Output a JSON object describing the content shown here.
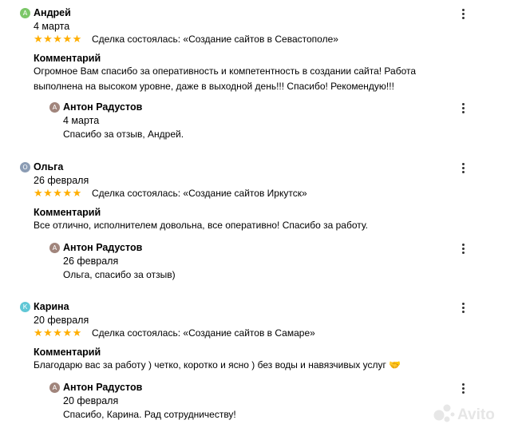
{
  "comment_label": "Комментарий",
  "stars_text": "★★★★★",
  "colors": {
    "avatar_green": "#7bc768",
    "avatar_gray_blue": "#8b9cb4",
    "avatar_teal": "#60c7d6",
    "avatar_brown": "#a1857c",
    "star": "#ffae00"
  },
  "reviews": [
    {
      "avatar_letter": "А",
      "author": "Андрей",
      "date": "4 марта",
      "deal": "Сделка состоялась: «Создание сайтов в Севастополе»",
      "comment": "Огромное Вам спасибо за оперативность и компетентность в создании сайта! Работа выполнена на высоком уровне, даже в выходной день!!! Спасибо! Рекомендую!!!",
      "reply": {
        "avatar_letter": "А",
        "author": "Антон Радустов",
        "date": "4 марта",
        "text": "Спасибо за отзыв, Андрей."
      }
    },
    {
      "avatar_letter": "О",
      "author": "Ольга",
      "date": "26 февраля",
      "deal": "Сделка состоялась: «Создание сайтов Иркутск»",
      "comment": "Все отлично, исполнителем довольна, все оперативно! Спасибо за работу.",
      "reply": {
        "avatar_letter": "А",
        "author": "Антон Радустов",
        "date": "26 февраля",
        "text": "Ольга, спасибо за отзыв)"
      }
    },
    {
      "avatar_letter": "К",
      "author": "Карина",
      "date": "20 февраля",
      "deal": "Сделка состоялась: «Создание сайтов в Самаре»",
      "comment": "Благодарю вас за работу ) четко, коротко и ясно ) без воды и навязчивых услуг 🤝",
      "reply": {
        "avatar_letter": "А",
        "author": "Антон Радустов",
        "date": "20 февраля",
        "text": "Спасибо, Карина. Рад сотрудничеству!"
      }
    }
  ],
  "watermark": "Avito"
}
